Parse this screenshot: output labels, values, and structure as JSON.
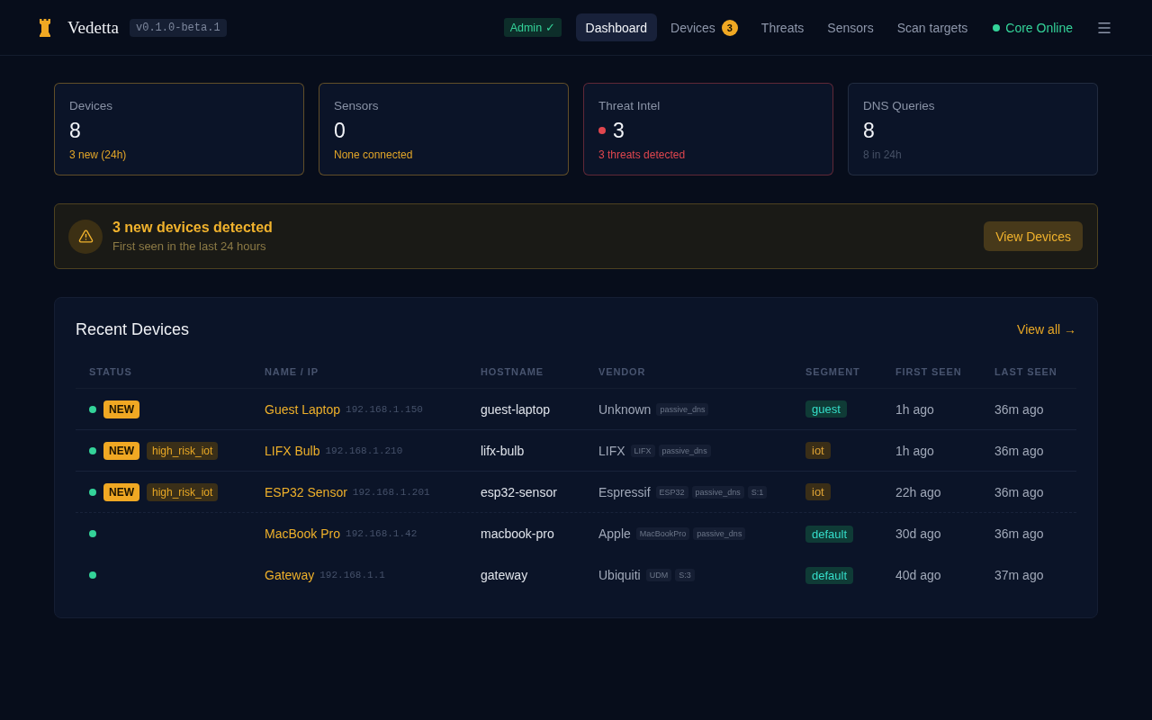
{
  "header": {
    "brand": "Vedetta",
    "version": "v0.1.0-beta.1",
    "role_badge": "Admin ✓",
    "nav": [
      {
        "label": "Dashboard",
        "selected": true
      },
      {
        "label": "Devices",
        "selected": false,
        "count": "3"
      },
      {
        "label": "Threats",
        "selected": false
      },
      {
        "label": "Sensors",
        "selected": false
      },
      {
        "label": "Scan targets",
        "selected": false
      }
    ],
    "core_status": {
      "label": "Core Online",
      "online": true
    }
  },
  "stats": [
    {
      "label": "Devices",
      "value": "8",
      "note": "3 new (24h)",
      "color": "#e3a628",
      "dot": false
    },
    {
      "label": "Sensors",
      "value": "0",
      "note": "None connected",
      "color": "#e3a628",
      "dot": false
    },
    {
      "label": "Threat Intel",
      "value": "3",
      "note": "3 threats detected",
      "color": "#e0464e",
      "dot": true
    },
    {
      "label": "DNS Queries",
      "value": "8",
      "note": "8 in 24h",
      "color": "#465065",
      "dot": false
    }
  ],
  "alert": {
    "title": "3 new devices detected",
    "subtitle": "First seen in the last 24 hours",
    "button": "View Devices"
  },
  "recent_devices": {
    "title": "Recent Devices",
    "link": "View all →",
    "columns": [
      "STATUS",
      "NAME / IP",
      "HOSTNAME",
      "VENDOR",
      "SEGMENT",
      "FIRST SEEN",
      "LAST SEEN"
    ],
    "rows": [
      {
        "online": true,
        "badges": [
          {
            "label": "NEW",
            "kind": "new"
          }
        ],
        "name": "Guest Laptop",
        "ip": "192.168.1.150",
        "hostname": "guest-laptop",
        "vendor": "Unknown",
        "vendor_tags": [
          "passive_dns"
        ],
        "segment": {
          "label": "guest",
          "color": "#0f3b36"
        },
        "first_seen": "1h ago",
        "last_seen": "36m ago"
      },
      {
        "online": true,
        "badges": [
          {
            "label": "NEW",
            "kind": "new"
          },
          {
            "label": "high_risk_iot",
            "kind": "risk"
          }
        ],
        "name": "LIFX Bulb",
        "ip": "192.168.1.210",
        "hostname": "lifx-bulb",
        "vendor": "LIFX",
        "vendor_tags": [
          "LIFX",
          "passive_dns"
        ],
        "segment": {
          "label": "iot",
          "color": "#3a2e17"
        },
        "first_seen": "1h ago",
        "last_seen": "36m ago"
      },
      {
        "online": true,
        "badges": [
          {
            "label": "NEW",
            "kind": "new"
          },
          {
            "label": "high_risk_iot",
            "kind": "risk"
          }
        ],
        "name": "ESP32 Sensor",
        "ip": "192.168.1.201",
        "hostname": "esp32-sensor",
        "vendor": "Espressif",
        "vendor_tags": [
          "ESP32",
          "passive_dns",
          "S:1"
        ],
        "segment": {
          "label": "iot",
          "color": "#3a2e17"
        },
        "first_seen": "22h ago",
        "last_seen": "36m ago"
      },
      {
        "online": true,
        "badges": [],
        "name": "MacBook Pro",
        "ip": "192.168.1.42",
        "hostname": "macbook-pro",
        "vendor": "Apple",
        "vendor_tags": [
          "MacBookPro",
          "passive_dns"
        ],
        "segment": {
          "label": "default",
          "color": "#0f3b36"
        },
        "first_seen": "30d ago",
        "last_seen": "36m ago"
      },
      {
        "online": true,
        "badges": [],
        "name": "Gateway",
        "ip": "192.168.1.1",
        "hostname": "gateway",
        "vendor": "Ubiquiti",
        "vendor_tags": [
          "UDM",
          "S:3"
        ],
        "segment": {
          "label": "default",
          "color": "#0f3b36"
        },
        "first_seen": "40d ago",
        "last_seen": "37m ago"
      }
    ]
  }
}
